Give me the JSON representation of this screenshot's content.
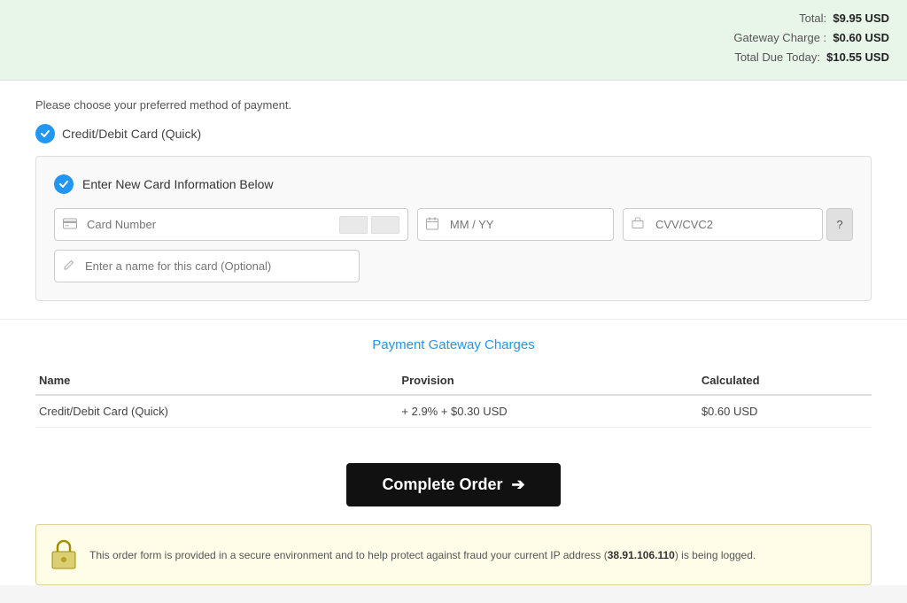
{
  "summary": {
    "total_label": "Total:",
    "total_value": "$9.95 USD",
    "gateway_charge_label": "Gateway Charge :",
    "gateway_charge_value": "$0.60 USD",
    "total_due_label": "Total Due Today:",
    "total_due_value": "$10.55 USD"
  },
  "payment": {
    "choose_label": "Please choose your preferred method of payment.",
    "method_label": "Credit/Debit Card (Quick)"
  },
  "card_form": {
    "header": "Enter New Card Information Below",
    "card_number_placeholder": "Card Number",
    "expiry_placeholder": "MM / YY",
    "cvv_placeholder": "CVV/CVC2",
    "cvv_help": "?",
    "card_name_placeholder": "Enter a name for this card (Optional)"
  },
  "gateway_charges": {
    "title": "Payment Gateway Charges",
    "columns": [
      "Name",
      "Provision",
      "Calculated"
    ],
    "rows": [
      {
        "name": "Credit/Debit Card (Quick)",
        "provision": "+ 2.9% + $0.30 USD",
        "calculated": "$0.60 USD"
      }
    ]
  },
  "complete_order": {
    "button_label": "Complete Order",
    "arrow": "➔"
  },
  "security": {
    "message_start": "This order form is provided in a secure environment and to help protect against fraud your current IP address (",
    "ip": "38.91.106.110",
    "message_end": ") is being logged."
  }
}
